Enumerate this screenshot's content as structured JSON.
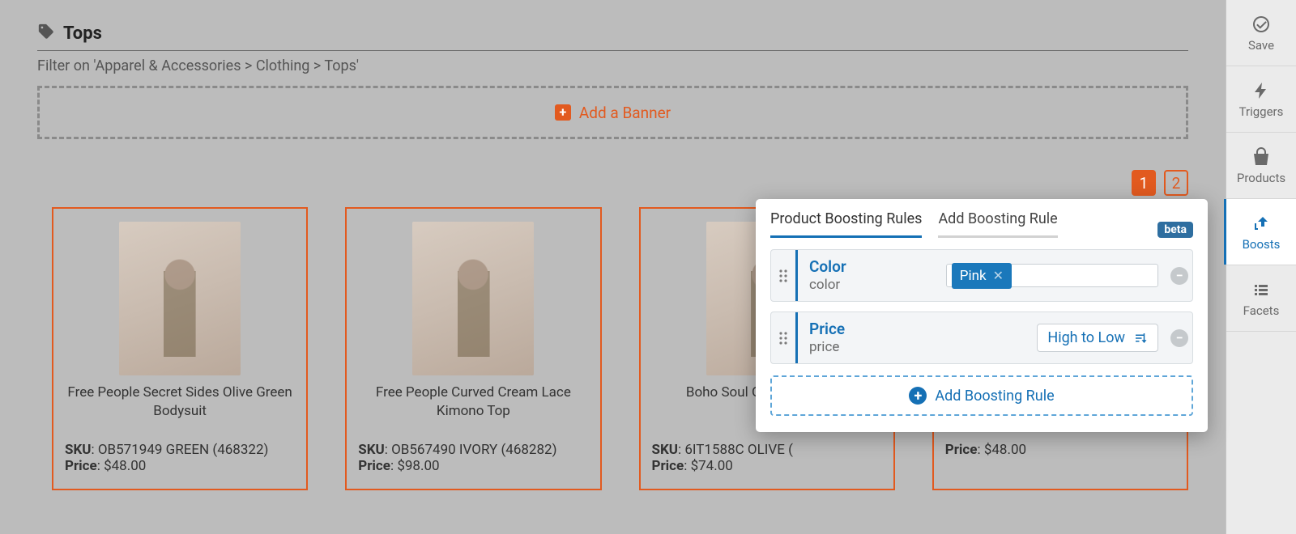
{
  "header": {
    "title": "Tops",
    "breadcrumb": "Filter on 'Apparel & Accessories > Clothing > Tops'"
  },
  "banner": {
    "add_label": "Add a Banner"
  },
  "pager": {
    "p1": "1",
    "p2": "2"
  },
  "cards": [
    {
      "name": "Free People Secret Sides Olive Green Bodysuit",
      "sku_label": "SKU",
      "sku": "OB571949 GREEN (468322)",
      "price_label": "Price",
      "price": "$48.00"
    },
    {
      "name": "Free People Curved Cream Lace Kimono Top",
      "sku_label": "SKU",
      "sku": "OB567490 IVORY (468282)",
      "price_label": "Price",
      "price": "$98.00"
    },
    {
      "name": "Boho Soul Olive Green Top",
      "sku_label": "SKU",
      "sku": "6IT1588C OLIVE (",
      "price_label": "Price",
      "price": "$74.00"
    },
    {
      "name": "",
      "sku_label": "",
      "sku": "",
      "price_label": "Price",
      "price": "$48.00"
    }
  ],
  "sidebar": {
    "save": "Save",
    "triggers": "Triggers",
    "products": "Products",
    "boosts": "Boosts",
    "facets": "Facets"
  },
  "popover": {
    "tab_rules": "Product Boosting Rules",
    "tab_add": "Add Boosting Rule",
    "beta": "beta",
    "rules": [
      {
        "name": "Color",
        "field": "color",
        "chip": "Pink"
      },
      {
        "name": "Price",
        "field": "price",
        "sort": "High to Low"
      }
    ],
    "add_label": "Add Boosting Rule"
  }
}
